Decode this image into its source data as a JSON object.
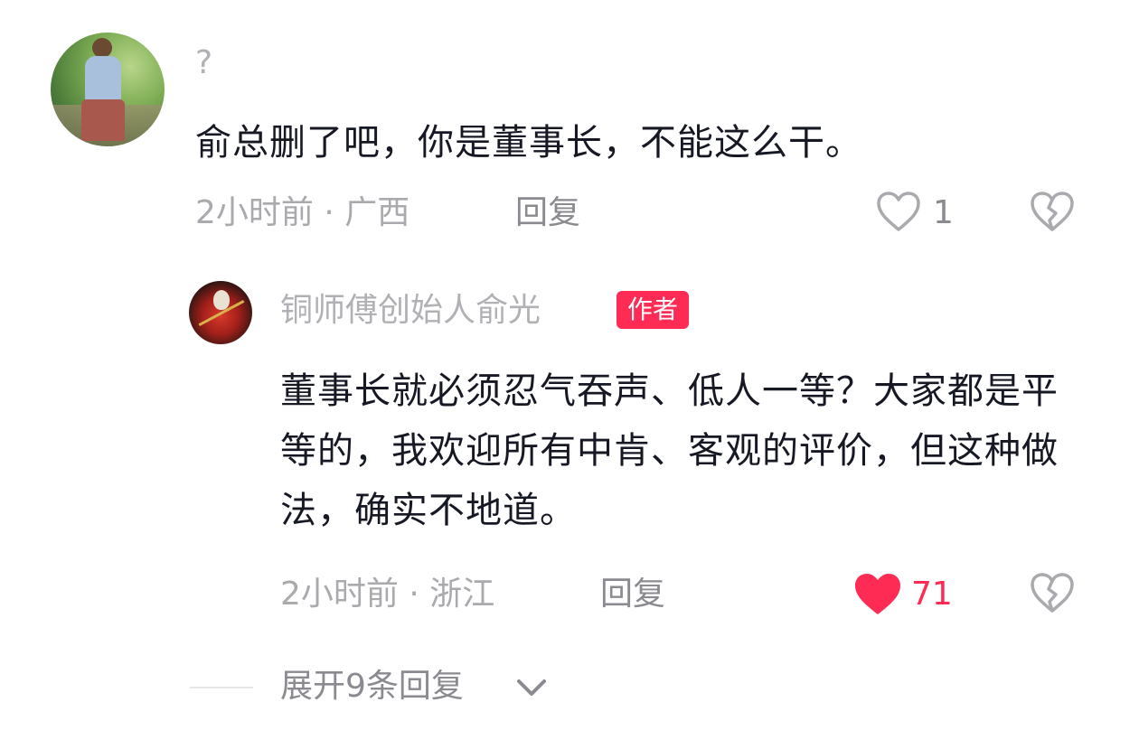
{
  "comment1": {
    "username": "?",
    "text": "俞总删了吧，你是董事长，不能这么干。",
    "meta": "2小时前 · 广西",
    "reply": "回复",
    "likes": "1"
  },
  "comment2": {
    "username": "铜师傅创始人俞光",
    "badge": "作者",
    "text": "董事长就必须忍气吞声、低人一等？大家都是平等的，我欢迎所有中肯、客观的评价，但这种做法，确实不地道。",
    "meta": "2小时前 · 浙江",
    "reply": "回复",
    "likes": "71"
  },
  "expand": {
    "label": "展开9条回复"
  },
  "colors": {
    "accent": "#fe2c55",
    "text": "#161823",
    "muted": "#a9a9ae"
  },
  "icons": {
    "like": "heart-outline-icon",
    "liked": "heart-filled-icon",
    "dislike": "broken-heart-icon",
    "expand": "chevron-down-icon"
  }
}
